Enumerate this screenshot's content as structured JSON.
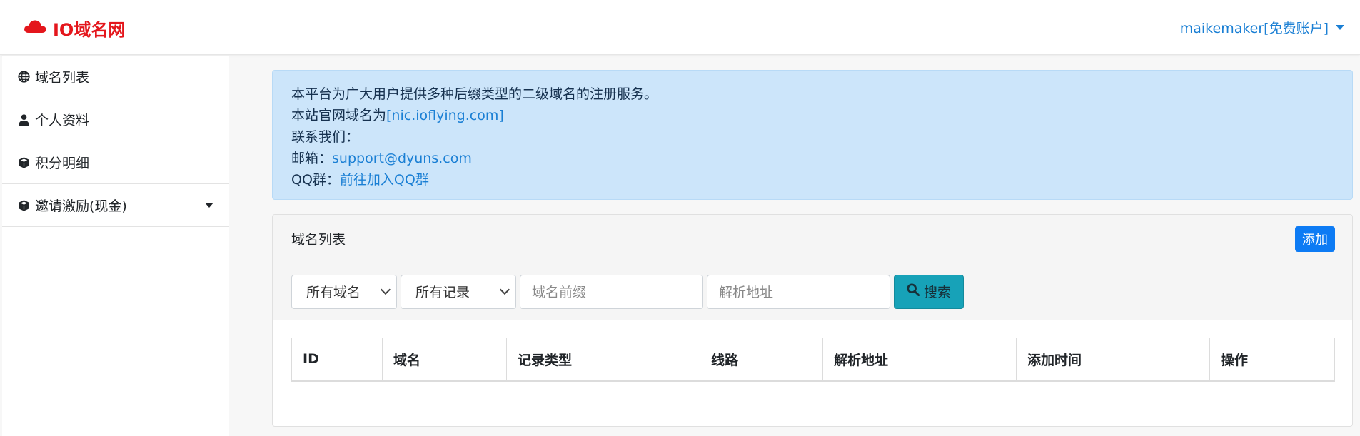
{
  "brand": {
    "name": "IO域名网",
    "color": "#e4161c"
  },
  "user": {
    "label": "maikemaker[免费账户]"
  },
  "sidebar": {
    "items": [
      {
        "label": "域名列表",
        "icon": "globe-icon"
      },
      {
        "label": "个人资料",
        "icon": "user-icon"
      },
      {
        "label": "积分明细",
        "icon": "cube-icon"
      },
      {
        "label": "邀请激励(现金)",
        "icon": "cube-icon"
      }
    ]
  },
  "notice": {
    "line1": "本平台为广大用户提供多种后缀类型的二级域名的注册服务。",
    "line2_prefix": "本站官网域名为",
    "line2_link": "[nic.ioflying.com]",
    "line3": "联系我们：",
    "email_label": "邮箱：",
    "email": "support@dyuns.com",
    "qq_label": "QQ群：",
    "qq_link": "前往加入QQ群"
  },
  "domain_card": {
    "title": "域名列表",
    "add_label": "添加",
    "filters": {
      "domain_select": "所有域名",
      "record_select": "所有记录",
      "prefix_placeholder": "域名前缀",
      "address_placeholder": "解析地址",
      "search_label": "搜索"
    },
    "columns": [
      "ID",
      "域名",
      "记录类型",
      "线路",
      "解析地址",
      "添加时间",
      "操作"
    ]
  },
  "colors": {
    "accent": "#0d7bf4",
    "link": "#1a7fd4",
    "alert_bg": "#cce5fa",
    "search_btn": "#17a2b8"
  }
}
